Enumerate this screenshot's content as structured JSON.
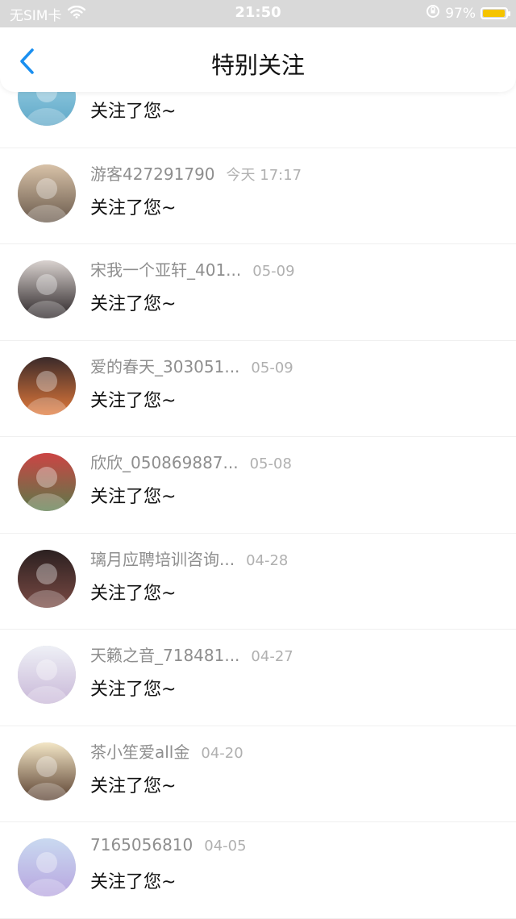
{
  "status_bar": {
    "carrier": "无SIM卡",
    "time": "21:50",
    "battery": "97%",
    "battery_level": 0.97,
    "icons": [
      "wifi-icon",
      "orientation-lock-icon",
      "battery-icon"
    ]
  },
  "nav": {
    "title": "特别关注",
    "back_icon": "chevron-left-icon"
  },
  "items": [
    {
      "name": "",
      "time": "",
      "message": "关注了您~",
      "avatar_colors": [
        "#9fd3e6",
        "#5fa8c8"
      ]
    },
    {
      "name": "游客427291790",
      "time": "今天 17:17",
      "message": "关注了您~",
      "avatar_colors": [
        "#d8c2a8",
        "#6a5a4c"
      ]
    },
    {
      "name": "宋我一个亚轩_401...",
      "time": "05-09",
      "message": "关注了您~",
      "avatar_colors": [
        "#d9d2cf",
        "#2a2426"
      ]
    },
    {
      "name": "爱的春天_303051...",
      "time": "05-09",
      "message": "关注了您~",
      "avatar_colors": [
        "#3b2a2a",
        "#e2793a"
      ]
    },
    {
      "name": "欣欣_050869887...",
      "time": "05-08",
      "message": "关注了您~",
      "avatar_colors": [
        "#c44",
        "#5a7a4a"
      ]
    },
    {
      "name": "璃月应聘培训咨询...",
      "time": "04-28",
      "message": "关注了您~",
      "avatar_colors": [
        "#2b2020",
        "#7a4a44"
      ]
    },
    {
      "name": "天籁之音_718481...",
      "time": "04-27",
      "message": "关注了您~",
      "avatar_colors": [
        "#eef0f6",
        "#c9b8d8"
      ]
    },
    {
      "name": "茶小笙爱all金",
      "time": "04-20",
      "message": "关注了您~",
      "avatar_colors": [
        "#f3e6c6",
        "#5a4030"
      ]
    },
    {
      "name": "7165056810",
      "time": "04-05",
      "message": "关注了您~",
      "avatar_colors": [
        "#c9d9f0",
        "#b8a6e0"
      ]
    }
  ],
  "colors": {
    "accent": "#1a8ff0",
    "name_gray": "#8e8e8e",
    "time_gray": "#b0b0b0",
    "status_bar_bg": "#d9d9d9"
  }
}
